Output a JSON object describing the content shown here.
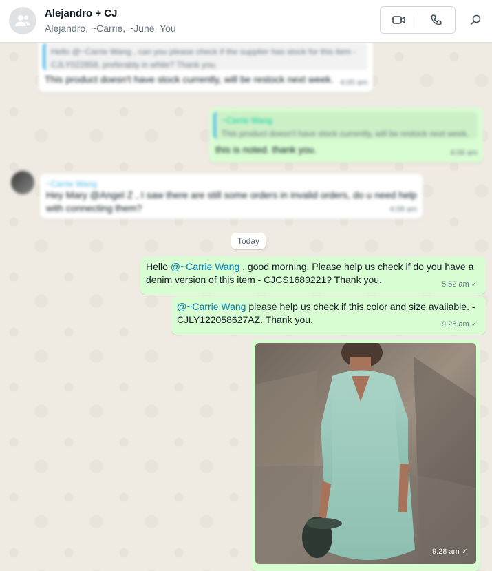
{
  "header": {
    "title": "Alejandro + CJ",
    "participants": "Alejandro, ~Carrie, ~June, You"
  },
  "icons": {
    "avatar": "group-avatar-icon",
    "video": "video-camera-icon",
    "voice": "phone-icon",
    "search": "search-icon"
  },
  "blurred_messages": {
    "m1_quote": "Hello @~Carrie Wang , can you please check if the supplier has stock for this item - CJLY022858, preferably in white? Thank you.",
    "m1_text": "This product doesn't have stock currently, will be restock next week.",
    "m1_time": "4:05 am",
    "m2_quote_author": "~Carrie Wang",
    "m2_quote_text": "This product doesn't have stock currently, will be restock next week.",
    "m2_text": "this is noted. thank you.",
    "m2_time": "4:06 am",
    "m3_author": "~Carrie Wang",
    "m3_text": "Hey Mary @Angel Z , I saw there are still some orders in invalid orders, do u need help with connecting them?",
    "m3_time": "4:08 am"
  },
  "day_separator": "Today",
  "messages": [
    {
      "prefix": "Hello ",
      "mention": "@~Carrie Wang",
      "text": " , good morning. Please help us check if do you have a denim version of this item - CJCS1689221? Thank you.",
      "time": "5:52 am",
      "status": "✓"
    },
    {
      "mention": "@~Carrie Wang",
      "text": " please help us check if this color and size available. - CJLY122058627AZ. Thank you.",
      "time": "9:28 am",
      "status": "✓"
    }
  ],
  "photo_message": {
    "time": "9:28 am",
    "status": "✓"
  },
  "colors": {
    "outgoing_bubble": "#d9fdd3",
    "incoming_bubble": "#ffffff",
    "mention": "#027eb5",
    "chat_background": "#efeae2"
  }
}
